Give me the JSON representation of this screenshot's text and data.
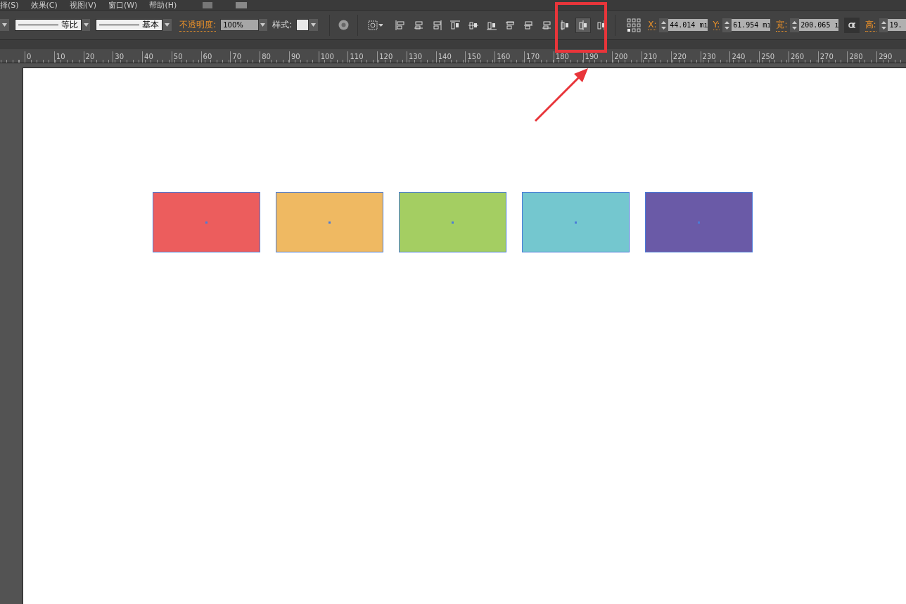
{
  "menu": [
    "择(S)",
    "效果(C)",
    "视图(V)",
    "窗口(W)",
    "帮助(H)"
  ],
  "toolbar": {
    "stroke_profile": "等比",
    "brush": "基本",
    "opacity_label": "不透明度:",
    "opacity": "100%",
    "style_label": "样式:",
    "align_buttons": [
      {
        "kind": "left",
        "selected": false
      },
      {
        "kind": "hcenter",
        "selected": false
      },
      {
        "kind": "right",
        "selected": false
      },
      {
        "kind": "top",
        "selected": false
      },
      {
        "kind": "vcenter",
        "selected": false
      },
      {
        "kind": "bottom",
        "selected": false
      },
      {
        "kind": "dtop",
        "selected": false
      },
      {
        "kind": "dvcenter",
        "selected": false
      },
      {
        "kind": "dbottom",
        "selected": false
      },
      {
        "kind": "dleft",
        "selected": false
      },
      {
        "kind": "dhcenter",
        "selected": true
      },
      {
        "kind": "dright",
        "selected": false
      }
    ],
    "fields": [
      {
        "label": "X:",
        "value": "44.014 mı"
      },
      {
        "label": "Y:",
        "value": "61.954 mı"
      },
      {
        "label": "宽:",
        "value": "200.065 ı"
      },
      {
        "label": "高:",
        "value": "19."
      }
    ]
  },
  "ruler": [
    "0",
    "10",
    "20",
    "30",
    "40",
    "50",
    "60",
    "70",
    "80",
    "90",
    "100",
    "110",
    "120",
    "130",
    "140",
    "150",
    "160",
    "170",
    "180",
    "190",
    "200",
    "210",
    "220",
    "230",
    "240",
    "250",
    "260",
    "270",
    "280",
    "290"
  ],
  "shapes": [
    {
      "color": "#ec5d5d"
    },
    {
      "color": "#efb962"
    },
    {
      "color": "#a4ce62"
    },
    {
      "color": "#74c7cf"
    },
    {
      "color": "#6a5aa7"
    }
  ]
}
